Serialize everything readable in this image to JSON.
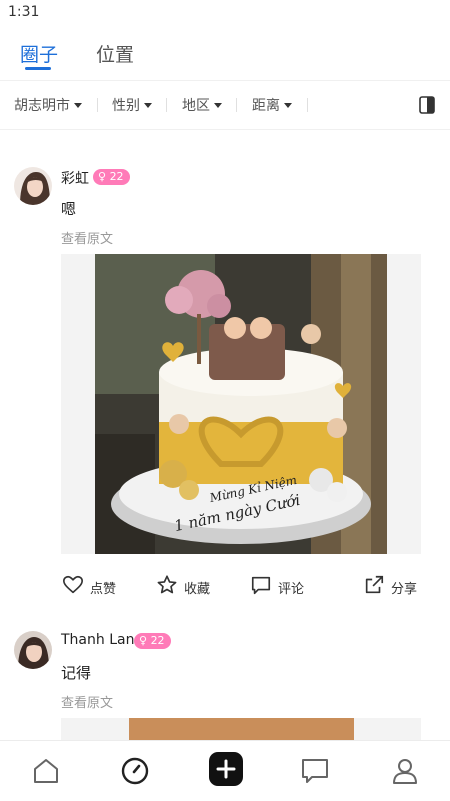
{
  "status_bar": {
    "time": "1:31"
  },
  "top_tabs": [
    {
      "label": "圈子",
      "active": true
    },
    {
      "label": "位置",
      "active": false
    }
  ],
  "filters": [
    {
      "label": "胡志明市"
    },
    {
      "label": "性别"
    },
    {
      "label": "地区"
    },
    {
      "label": "距离"
    }
  ],
  "posts": [
    {
      "username": "彩虹",
      "badge": "22",
      "content": "嗯",
      "view_original": "查看原文",
      "image_text": [
        "Mừng Kỉ Niệm",
        "1 năm ngày Cưới"
      ]
    },
    {
      "username": "Thanh Lan",
      "badge": "22",
      "content": "记得",
      "view_original": "查看原文"
    }
  ],
  "actions": {
    "like": "点赞",
    "favorite": "收藏",
    "comment": "评论",
    "share": "分享"
  },
  "bottom_nav": [
    {
      "icon": "home-icon"
    },
    {
      "icon": "discover-icon"
    },
    {
      "icon": "add-icon"
    },
    {
      "icon": "message-icon"
    },
    {
      "icon": "profile-icon"
    }
  ],
  "colors": {
    "accent": "#1e6fd9",
    "badge": "#ff7bb8",
    "muted_text": "#999999"
  }
}
